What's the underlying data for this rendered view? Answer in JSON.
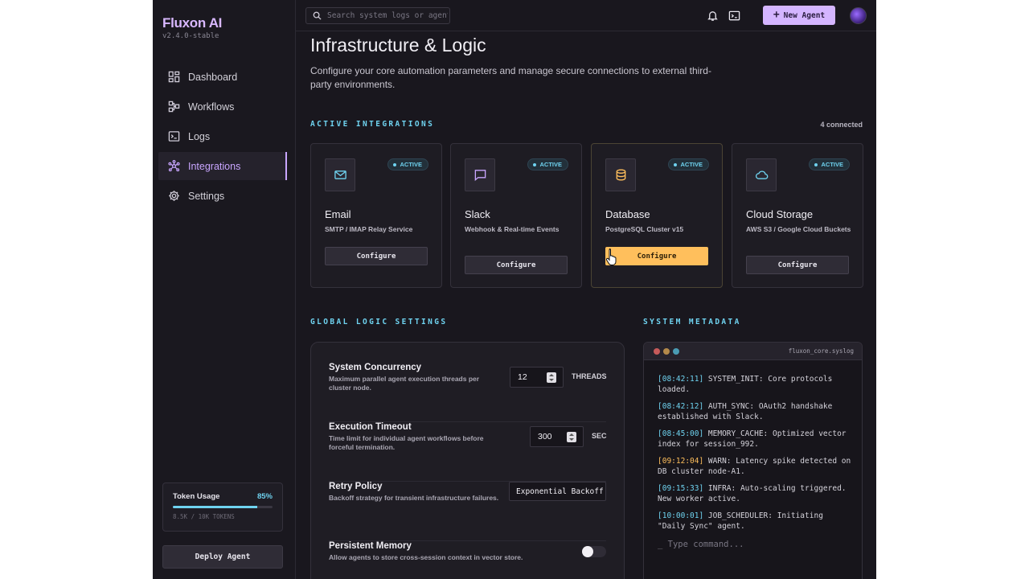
{
  "app": {
    "name": "Fluxon AI",
    "version": "v2.4.0-stable"
  },
  "sidebar": {
    "items": [
      {
        "label": "Dashboard",
        "icon": "dashboard-icon",
        "active": false
      },
      {
        "label": "Workflows",
        "icon": "workflow-icon",
        "active": false
      },
      {
        "label": "Logs",
        "icon": "terminal-icon",
        "active": false
      },
      {
        "label": "Integrations",
        "icon": "hub-icon",
        "active": true
      },
      {
        "label": "Settings",
        "icon": "gear-icon",
        "active": false
      }
    ],
    "token_usage": {
      "label": "Token Usage",
      "percent_label": "85%",
      "percent": 85,
      "detail": "8.5K / 10K TOKENS"
    },
    "deploy_label": "Deploy Agent"
  },
  "topbar": {
    "search_placeholder": "Search system logs or agents...",
    "new_agent_label": "New Agent",
    "icons": [
      "bell-icon",
      "terminal-icon"
    ]
  },
  "page": {
    "title": "Infrastructure & Logic",
    "description": "Configure your core automation parameters and manage secure connections to external third-party environments."
  },
  "integrations": {
    "label": "ACTIVE INTEGRATIONS",
    "connected": "4 connected",
    "cards": [
      {
        "name": "Email",
        "sub": "SMTP / IMAP Relay Service",
        "status": "ACTIVE",
        "icon": "mail-icon",
        "button": "Configure"
      },
      {
        "name": "Slack",
        "sub": "Webhook & Real-time Events",
        "status": "ACTIVE",
        "icon": "chat-icon",
        "button": "Configure"
      },
      {
        "name": "Database",
        "sub": "PostgreSQL Cluster v15",
        "status": "ACTIVE",
        "icon": "database-icon",
        "button": "Configure"
      },
      {
        "name": "Cloud Storage",
        "sub": "AWS S3 / Google Cloud Buckets",
        "status": "ACTIVE",
        "icon": "cloud-icon",
        "button": "Configure"
      }
    ]
  },
  "settings": {
    "label": "GLOBAL LOGIC SETTINGS",
    "concurrency": {
      "title": "System Concurrency",
      "desc": "Maximum parallel agent execution threads per cluster node.",
      "value": "12",
      "unit": "THREADS"
    },
    "timeout": {
      "title": "Execution Timeout",
      "desc": "Time limit for individual agent workflows before forceful termination.",
      "value": "300",
      "unit": "SEC"
    },
    "retry": {
      "title": "Retry Policy",
      "desc": "Backoff strategy for transient infrastructure failures.",
      "value": "Exponential Backoff"
    },
    "memory": {
      "title": "Persistent Memory",
      "desc": "Allow agents to store cross-session context in vector store.",
      "enabled": false
    }
  },
  "metadata": {
    "label": "SYSTEM METADATA",
    "file": "fluxon_core.syslog",
    "logs": [
      {
        "ts": "[08:42:11]",
        "text": " SYSTEM_INIT: Core protocols loaded.",
        "level": "info"
      },
      {
        "ts": "[08:42:12]",
        "text": " AUTH_SYNC: OAuth2 handshake established with Slack.",
        "level": "info"
      },
      {
        "ts": "[08:45:00]",
        "text": " MEMORY_CACHE: Optimized vector index for session_992.",
        "level": "info"
      },
      {
        "ts": "[09:12:04]",
        "text": " WARN: Latency spike detected on DB cluster node-A1.",
        "level": "warn"
      },
      {
        "ts": "[09:15:33]",
        "text": " INFRA: Auto-scaling triggered. New worker active.",
        "level": "info"
      },
      {
        "ts": "[10:00:01]",
        "text": " JOB_SCHEDULER: Initiating \"Daily Sync\" agent.",
        "level": "info"
      }
    ],
    "prompt": "_ Type command..."
  },
  "colors": {
    "accent": "#d4b5ff",
    "cyan": "#6fd3f0",
    "warn": "#ffbf5c",
    "bg": "#19171e"
  }
}
